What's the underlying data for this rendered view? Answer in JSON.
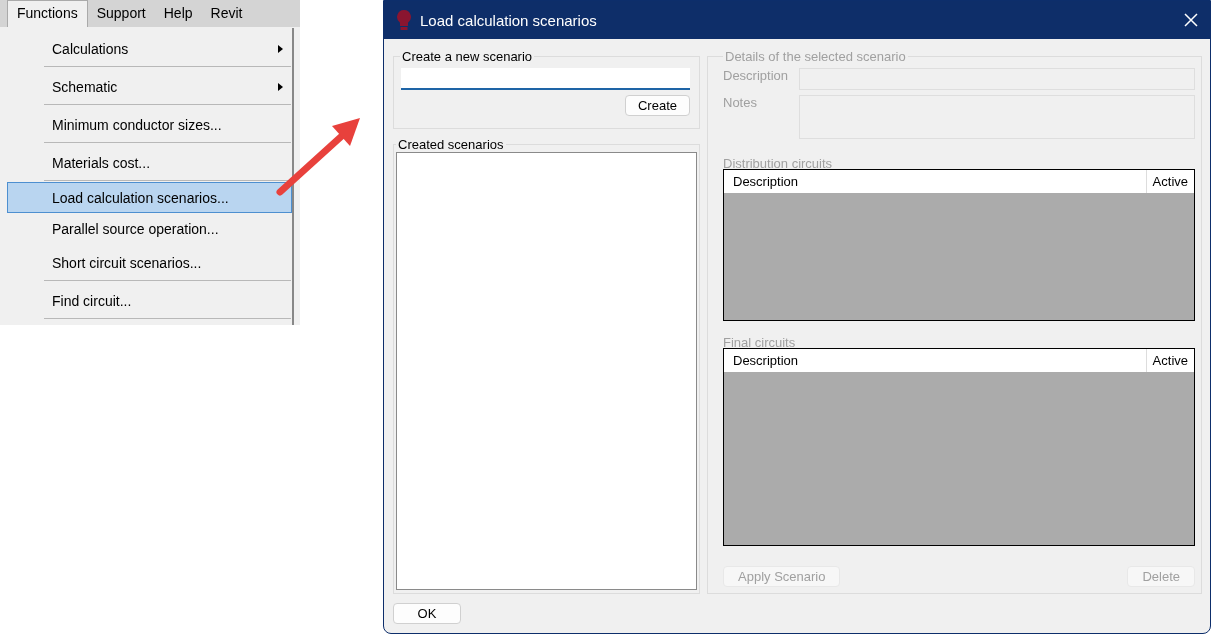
{
  "menu_bar": [
    {
      "label": "Functions",
      "selected": true
    },
    {
      "label": "Support",
      "selected": false
    },
    {
      "label": "Help",
      "selected": false
    },
    {
      "label": "Revit",
      "selected": false
    }
  ],
  "menu": [
    {
      "label": "Calculations",
      "kind": "submenu",
      "separated": true,
      "selected": false
    },
    {
      "label": "Schematic",
      "kind": "submenu",
      "separated": true,
      "selected": false
    },
    {
      "label": "Minimum conductor sizes...",
      "kind": "action",
      "separated": true,
      "selected": false
    },
    {
      "label": "Materials cost...",
      "kind": "action",
      "separated": true,
      "selected": false
    },
    {
      "label": "Load calculation scenarios...",
      "kind": "action",
      "separated": false,
      "selected": true
    },
    {
      "label": "Parallel source operation...",
      "kind": "action",
      "separated": false,
      "selected": false
    },
    {
      "label": "Short circuit scenarios...",
      "kind": "action",
      "separated": true,
      "selected": false
    },
    {
      "label": "Find circuit...",
      "kind": "action",
      "separated": true,
      "selected": false
    }
  ],
  "dialog": {
    "title": "Load calculation scenarios",
    "create_group": {
      "title": "Create a new scenario",
      "button": "Create"
    },
    "list_group": {
      "title": "Created scenarios"
    },
    "details": {
      "title": "Details of the selected scenario",
      "disabled": true,
      "description_label": "Description",
      "notes_label": "Notes",
      "tables": [
        {
          "title": "Distribution circuits",
          "columns": [
            "Description",
            "Active"
          ]
        },
        {
          "title": "Final circuits",
          "columns": [
            "Description",
            "Active"
          ]
        }
      ],
      "buttons": [
        "Apply Scenario",
        "Delete"
      ]
    },
    "ok_button": "OK"
  }
}
